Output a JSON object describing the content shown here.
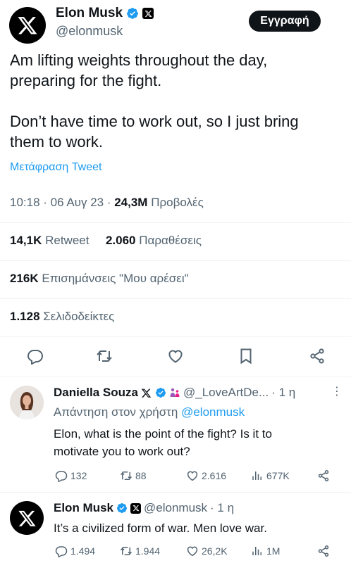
{
  "tweet": {
    "author_name": "Elon Musk",
    "author_handle": "@elonmusk",
    "signup_button": "Εγγραφή",
    "text_line1": "Am lifting weights throughout the day,",
    "text_line2": "preparing for the fight.",
    "text_line3": "Don’t have time to work out, so I just bring",
    "text_line4": "them to work.",
    "translate": "Μετάφραση Tweet",
    "time": "10:18 · 06 Αυγ 23 · ",
    "views_count": "24,3M",
    "views_label": " Προβολές",
    "retweets_count": "14,1K",
    "retweets_label": " Retweet",
    "quotes_count": "2.060",
    "quotes_label": " Παραθέσεις",
    "likes_count": "216K",
    "likes_label": " Επισημάνσεις \"Μου αρέσει\"",
    "bookmarks_count": "1.128",
    "bookmarks_label": " Σελιδοδείκτες"
  },
  "replies": [
    {
      "author_name": "Daniella Souza",
      "author_handle": "@_LoveArtDe...",
      "time": " · 1 η",
      "reply_prefix": "Απάντηση στον χρήστη ",
      "reply_to": "@elonmusk",
      "text_line1": "Elon, what is the point of the fight? Is it to",
      "text_line2": "motivate you to work out?",
      "replies": "132",
      "retweets": "88",
      "likes": "2.616",
      "views": "677K"
    },
    {
      "author_name": "Elon Musk",
      "author_handle": "@elonmusk",
      "time": " · 1 η",
      "text_line1": "It’s a civilized form of war. Men love war.",
      "replies": "1.494",
      "retweets": "1.944",
      "likes": "26,2K",
      "views": "1M"
    }
  ],
  "colors": {
    "accent": "#1d9bf0",
    "text": "#0f1419",
    "muted": "#536471",
    "button": "#0f1419"
  },
  "icons": [
    "x-logo-icon",
    "verified-badge-icon",
    "reply-icon",
    "retweet-icon",
    "like-icon",
    "bookmark-icon",
    "share-icon",
    "views-icon",
    "more-icon"
  ]
}
